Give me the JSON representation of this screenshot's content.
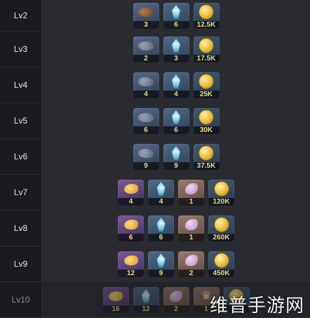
{
  "levels": [
    {
      "label": "Lv2",
      "items": [
        {
          "icon": "ore-icon",
          "count": "3"
        },
        {
          "icon": "crystal-icon",
          "count": "6"
        },
        {
          "icon": "coin-icon",
          "count": "12.5K"
        }
      ]
    },
    {
      "label": "Lv3",
      "items": [
        {
          "icon": "ore-icon",
          "count": "2"
        },
        {
          "icon": "crystal-icon",
          "count": "3"
        },
        {
          "icon": "coin-icon",
          "count": "17.5K"
        }
      ]
    },
    {
      "label": "Lv4",
      "items": [
        {
          "icon": "ore-icon",
          "count": "4"
        },
        {
          "icon": "crystal-icon",
          "count": "4"
        },
        {
          "icon": "coin-icon",
          "count": "25K"
        }
      ]
    },
    {
      "label": "Lv5",
      "items": [
        {
          "icon": "ore-icon",
          "count": "6"
        },
        {
          "icon": "crystal-icon",
          "count": "6"
        },
        {
          "icon": "coin-icon",
          "count": "30K"
        }
      ]
    },
    {
      "label": "Lv6",
      "items": [
        {
          "icon": "ore-icon",
          "count": "9"
        },
        {
          "icon": "crystal-icon",
          "count": "9"
        },
        {
          "icon": "coin-icon",
          "count": "37.5K"
        }
      ]
    },
    {
      "label": "Lv7",
      "items": [
        {
          "icon": "horn-icon",
          "count": "4"
        },
        {
          "icon": "crystal-icon",
          "count": "4"
        },
        {
          "icon": "shell-icon",
          "count": "1"
        },
        {
          "icon": "coin-icon",
          "count": "120K"
        }
      ]
    },
    {
      "label": "Lv8",
      "items": [
        {
          "icon": "horn-icon",
          "count": "6"
        },
        {
          "icon": "crystal-icon",
          "count": "6"
        },
        {
          "icon": "shell-icon",
          "count": "1"
        },
        {
          "icon": "coin-icon",
          "count": "260K"
        }
      ]
    },
    {
      "label": "Lv9",
      "items": [
        {
          "icon": "horn-icon",
          "count": "12"
        },
        {
          "icon": "crystal-icon",
          "count": "9"
        },
        {
          "icon": "shell-icon",
          "count": "2"
        },
        {
          "icon": "coin-icon",
          "count": "450K"
        }
      ]
    },
    {
      "label": "Lv10",
      "items": [
        {
          "icon": "horn-icon",
          "count": "16"
        },
        {
          "icon": "crystal-icon",
          "count": "12"
        },
        {
          "icon": "shell-icon",
          "count": "2"
        },
        {
          "icon": "crown-icon",
          "count": "1"
        },
        {
          "icon": "coin-icon",
          "count": ""
        }
      ]
    }
  ],
  "watermark": "维普手游网",
  "colors": {
    "count_text": "#ecd98b",
    "row_bg": "#2a2b30",
    "label_bg": "#1a1b1e"
  }
}
